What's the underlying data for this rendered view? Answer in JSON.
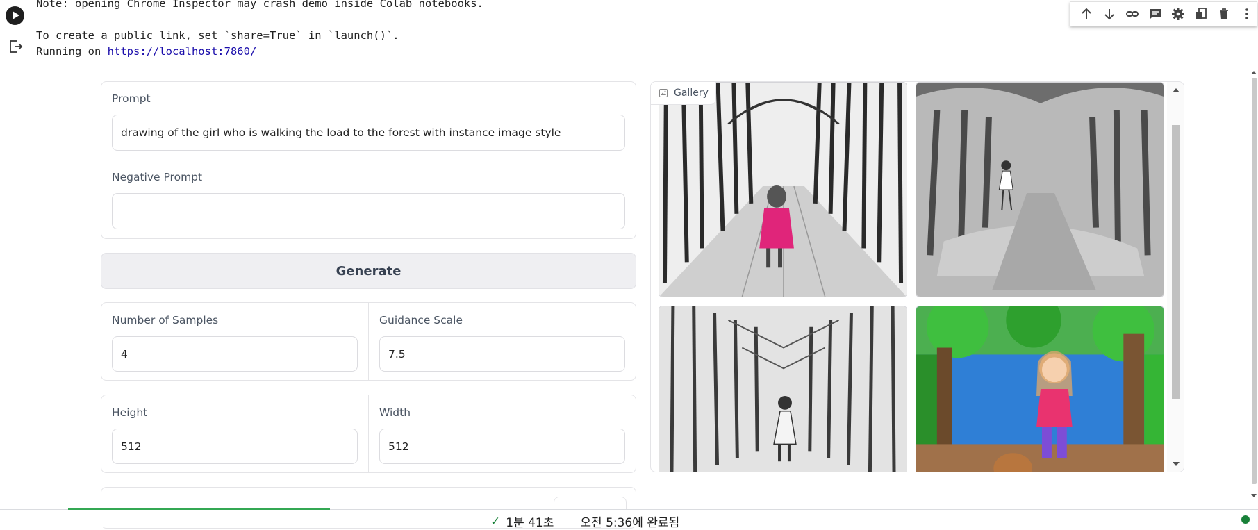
{
  "console": {
    "line1": "Note: opening Chrome Inspector may crash demo inside Colab notebooks.",
    "line2": "",
    "line3": "To create a public link, set `share=True` in `launch()`.",
    "line4_prefix": "Running on ",
    "link": "https://localhost:7860/"
  },
  "cell_toolbar": {
    "icons": [
      "arrow-up-icon",
      "arrow-down-icon",
      "link-icon",
      "comment-icon",
      "gear-icon",
      "mirror-cell-icon",
      "trash-icon",
      "more-vert-icon"
    ]
  },
  "form": {
    "prompt_label": "Prompt",
    "prompt_value": "drawing of the girl who is walking the load to the forest with instance image style",
    "negative_label": "Negative Prompt",
    "negative_value": "",
    "generate_label": "Generate",
    "samples_label": "Number of Samples",
    "samples_value": "4",
    "guidance_label": "Guidance Scale",
    "guidance_value": "7.5",
    "height_label": "Height",
    "height_value": "512",
    "width_label": "Width",
    "width_value": "512"
  },
  "gallery": {
    "label": "Gallery",
    "images": [
      {
        "name": "gallery-image-1",
        "style": "pencil-pink-dress"
      },
      {
        "name": "gallery-image-2",
        "style": "pencil-grey"
      },
      {
        "name": "gallery-image-3",
        "style": "pencil-dark-forest"
      },
      {
        "name": "gallery-image-4",
        "style": "color-pencil"
      }
    ]
  },
  "status": {
    "check": "✓",
    "elapsed": "1분 41초",
    "completed": "오전 5:36에 완료됨"
  },
  "colors": {
    "link": "#1a0dab",
    "progress": "#34a853",
    "status_dot": "#188038"
  }
}
